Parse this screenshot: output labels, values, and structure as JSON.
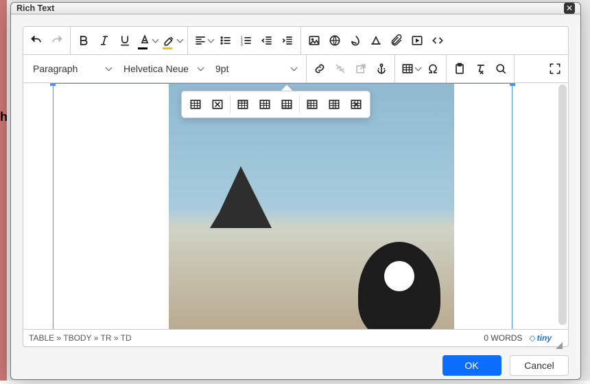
{
  "dialog": {
    "title": "Rich Text",
    "ok": "OK",
    "cancel": "Cancel"
  },
  "dropdowns": {
    "paragraph": "Paragraph",
    "font_family": "Helvetica Neue",
    "font_size": "9pt"
  },
  "status": {
    "path": "TABLE » TBODY » TR » TD",
    "word_count": "0 WORDS",
    "branding": "tiny"
  },
  "toolbar_row1": {
    "history": [
      "undo",
      "redo"
    ],
    "format_text": [
      "bold",
      "italic",
      "underline",
      "text-color",
      "highlight"
    ],
    "paragraph": [
      "align",
      "bullet-list",
      "number-list",
      "outdent",
      "indent"
    ],
    "insert": [
      "image",
      "link-globe",
      "ink",
      "page-break",
      "attach",
      "media",
      "code"
    ]
  },
  "toolbar_row2": {
    "links": [
      "insert-link",
      "remove-link",
      "open-link",
      "anchor"
    ],
    "misc": [
      "table",
      "special-char"
    ],
    "clipboard": [
      "paste",
      "clear-format",
      "find"
    ],
    "view": [
      "fullscreen"
    ]
  },
  "floating_toolbar": [
    "table-properties",
    "delete-table",
    "row-before",
    "cell-properties",
    "row-after",
    "col-before",
    "col-properties",
    "col-after"
  ]
}
